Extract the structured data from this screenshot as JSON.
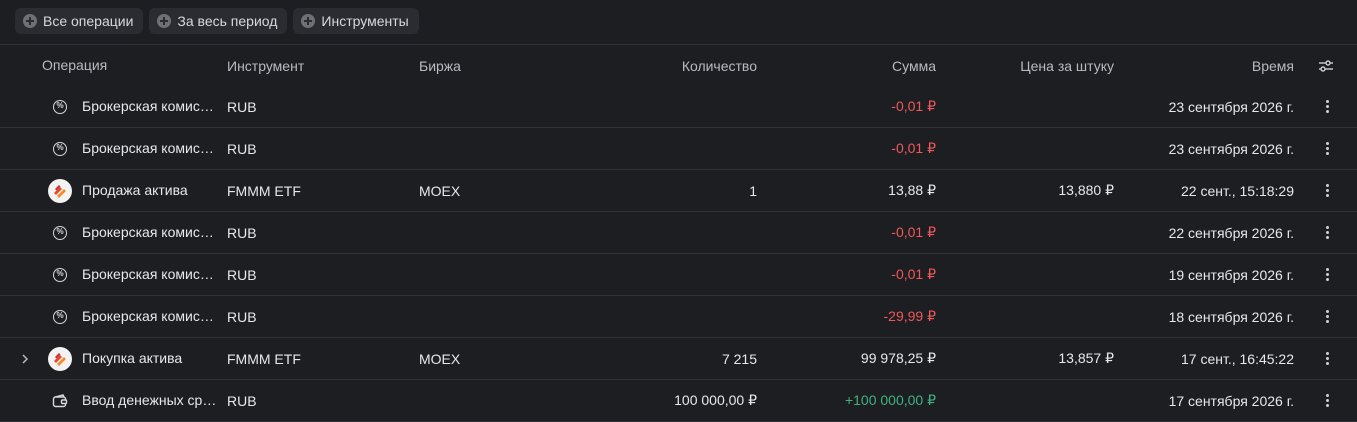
{
  "filters": [
    {
      "label": "Все операции"
    },
    {
      "label": "За весь период"
    },
    {
      "label": "Инструменты"
    }
  ],
  "columns": {
    "operation": "Операция",
    "instrument": "Инструмент",
    "exchange": "Биржа",
    "quantity": "Количество",
    "amount": "Сумма",
    "price": "Цена за штуку",
    "time": "Время"
  },
  "rows": [
    {
      "icon": "percent-icon",
      "operation": "Брокерская комиссия",
      "instrument": "RUB",
      "exchange": "",
      "quantity": "",
      "amount": "-0,01 ₽",
      "amount_type": "negative",
      "price": "",
      "time": "23 сентября 2026 г.",
      "expandable": false
    },
    {
      "icon": "percent-icon",
      "operation": "Брокерская комиссия",
      "instrument": "RUB",
      "exchange": "",
      "quantity": "",
      "amount": "-0,01 ₽",
      "amount_type": "negative",
      "price": "",
      "time": "23 сентября 2026 г.",
      "expandable": false
    },
    {
      "icon": "asset-logo-icon",
      "operation": "Продажа актива",
      "instrument": "FMMM ETF",
      "exchange": "MOEX",
      "quantity": "1",
      "amount": "13,88 ₽",
      "amount_type": "neutral",
      "price": "13,880 ₽",
      "time": "22 сент., 15:18:29",
      "expandable": false
    },
    {
      "icon": "percent-icon",
      "operation": "Брокерская комиссия",
      "instrument": "RUB",
      "exchange": "",
      "quantity": "",
      "amount": "-0,01 ₽",
      "amount_type": "negative",
      "price": "",
      "time": "22 сентября 2026 г.",
      "expandable": false
    },
    {
      "icon": "percent-icon",
      "operation": "Брокерская комиссия",
      "instrument": "RUB",
      "exchange": "",
      "quantity": "",
      "amount": "-0,01 ₽",
      "amount_type": "negative",
      "price": "",
      "time": "19 сентября 2026 г.",
      "expandable": false
    },
    {
      "icon": "percent-icon",
      "operation": "Брокерская комиссия",
      "instrument": "RUB",
      "exchange": "",
      "quantity": "",
      "amount": "-29,99 ₽",
      "amount_type": "negative",
      "price": "",
      "time": "18 сентября 2026 г.",
      "expandable": false
    },
    {
      "icon": "asset-logo-icon",
      "operation": "Покупка актива",
      "instrument": "FMMM ETF",
      "exchange": "MOEX",
      "quantity": "7 215",
      "amount": "99 978,25 ₽",
      "amount_type": "neutral",
      "price": "13,857 ₽",
      "time": "17 сент., 16:45:22",
      "expandable": true
    },
    {
      "icon": "wallet-icon",
      "operation": "Ввод денежных средств",
      "instrument": "RUB",
      "exchange": "",
      "quantity": "100 000,00 ₽",
      "amount": "+100 000,00 ₽",
      "amount_type": "positive",
      "price": "",
      "time": "17 сентября 2026 г.",
      "expandable": false
    }
  ],
  "colors": {
    "background": "#1d1e22",
    "negative": "#f0575b",
    "positive": "#3fb27f",
    "text": "#e8e8ea"
  }
}
